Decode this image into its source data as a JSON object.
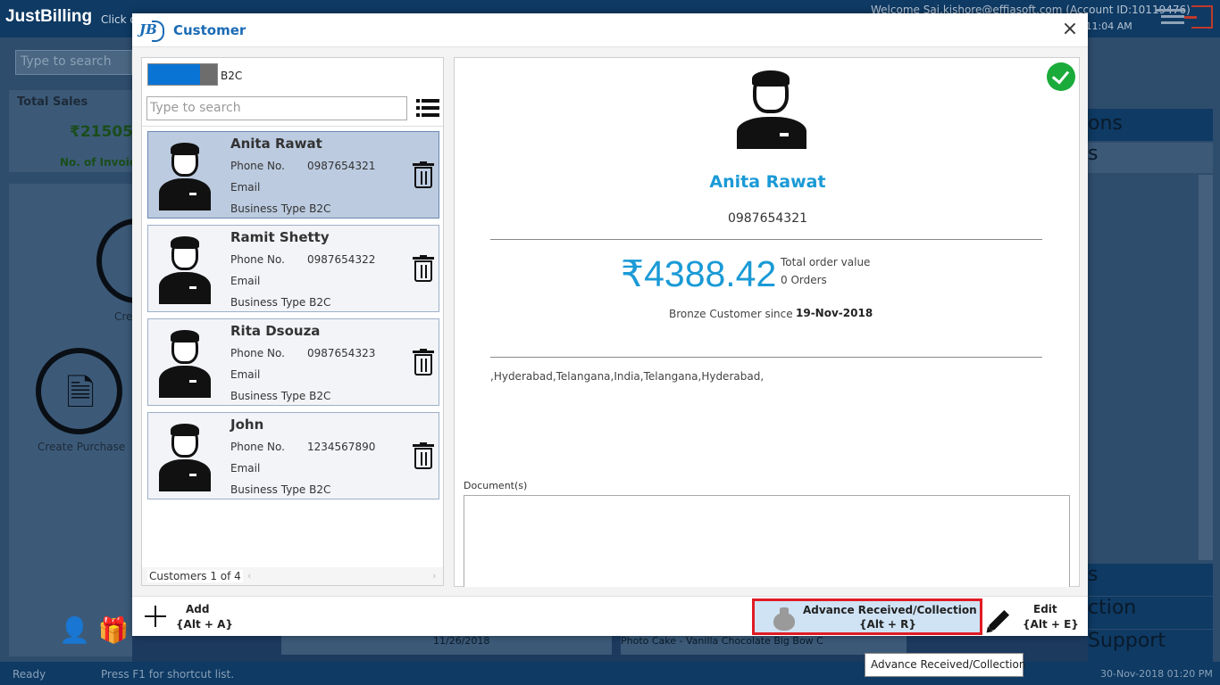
{
  "app": {
    "logo": "JustBilling",
    "click_hint": "Click o",
    "welcome": "Welcome Sai.kishore@effiasoft.com (Account ID:10119476)",
    "datetime": "18 11:04 AM",
    "search_placeholder": "Type to search",
    "total_sales_label": "Total Sales",
    "total_sales_value": "₹21505.",
    "invoices_label": "No. of Invoic",
    "create_label": "Cre",
    "create_purchase_label": "Create Purchase",
    "right_band1": "ons",
    "right_band2": "s",
    "right_tab1": "s",
    "right_tab2": "ction",
    "right_tab3": "Support",
    "bottom_strip1": "11/26/2018",
    "bottom_strip2": "Photo Cake - Vanilla      Chocolate Big Bow C"
  },
  "statusbar": {
    "ready": "Ready",
    "hint": "Press F1 for shortcut list.",
    "date": "30-Nov-2018 01:20 PM"
  },
  "dialog": {
    "logo": "JB",
    "title": "Customer",
    "close": "×",
    "toggle_label": "B2C",
    "search_placeholder": "Type to search",
    "customers": [
      {
        "name": "Anita Rawat",
        "phone_label": "Phone No.",
        "phone": "0987654321",
        "email_label": "Email",
        "business_type": "Business Type  B2C"
      },
      {
        "name": "Ramit Shetty",
        "phone_label": "Phone No.",
        "phone": "0987654322",
        "email_label": "Email",
        "business_type": "Business Type  B2C"
      },
      {
        "name": "Rita Dsouza",
        "phone_label": "Phone No.",
        "phone": "0987654323",
        "email_label": "Email",
        "business_type": "Business Type  B2C"
      },
      {
        "name": "John",
        "phone_label": "Phone No.",
        "phone": "1234567890",
        "email_label": "Email",
        "business_type": "Business Type  B2C"
      }
    ],
    "list_count": "Customers  1 of 4",
    "detail": {
      "name": "Anita Rawat",
      "phone": "0987654321",
      "amount": "₹4388.42",
      "amount_label": "Total order value",
      "orders": "0 Orders",
      "since_label": "Bronze Customer since",
      "since_date": "19-Nov-2018",
      "address": ",Hyderabad,Telangana,India,Telangana,Hyderabad,",
      "documents_label": "Document(s)"
    },
    "actions": {
      "add_label": "Add",
      "add_key": "{Alt + A}",
      "advance_label": "Advance Received/Collection",
      "advance_key": "{Alt + R}",
      "edit_label": "Edit",
      "edit_key": "{Alt + E}"
    },
    "tooltip": "Advance Received/Collection"
  }
}
